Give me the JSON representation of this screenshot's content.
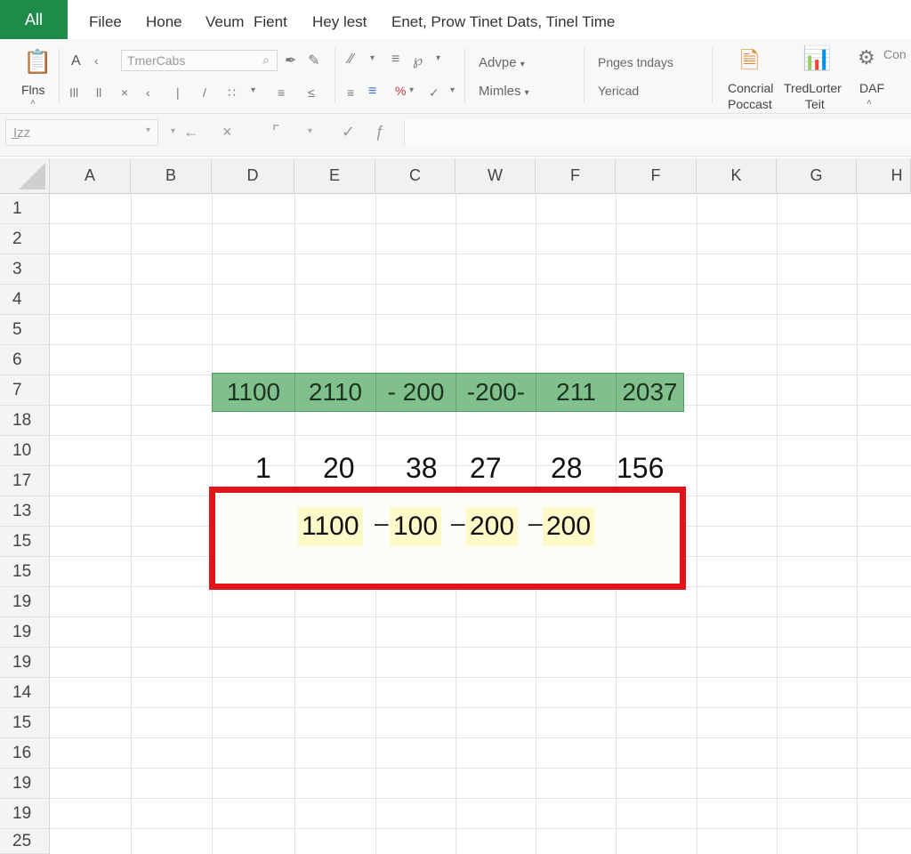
{
  "menubar": {
    "app_label": "All",
    "items": [
      "Filee",
      "Hone",
      "Veum",
      "Fient",
      "Hey lest",
      "Enet, Prow Tinet Dats, Tinel Time"
    ]
  },
  "ribbon": {
    "paste_label": "Flns",
    "font_name_placeholder": "TmerCabs",
    "align_group_label": "Advpe",
    "number_group_label": "Mimles",
    "pages_label": "Pnges tndays",
    "view_label": "Yericad",
    "cond_label_1": "Concrial",
    "cond_label_2": "Poccast",
    "trend_label_1": "TredLorter",
    "trend_label_2": "Teit",
    "daf_label": "DAF",
    "conn_label": "Con"
  },
  "formula": {
    "namebox_value": "I̲zz"
  },
  "columns": [
    "A",
    "B",
    "D",
    "E",
    "C",
    "W",
    "F",
    "F",
    "K",
    "G",
    "H"
  ],
  "rows": [
    "1",
    "2",
    "3",
    "4",
    "5",
    "6",
    "7",
    "18",
    "10",
    "17",
    "13",
    "15",
    "15",
    "19",
    "19",
    "19",
    "14",
    "15",
    "16",
    "19",
    "19",
    "25"
  ],
  "green_values": [
    "1100",
    "2110",
    "- 200",
    "-200-",
    "211",
    "2037"
  ],
  "plain_numbers": [
    "1",
    "20",
    "38",
    "27",
    "28",
    "156"
  ],
  "highlighted_values": [
    "1100",
    "100",
    "200",
    "200"
  ],
  "colors": {
    "accent_green": "#1e8b4a",
    "highlight_green": "#80c08c",
    "box_red": "#e0141a",
    "cell_yellow": "#fdf9c8"
  }
}
